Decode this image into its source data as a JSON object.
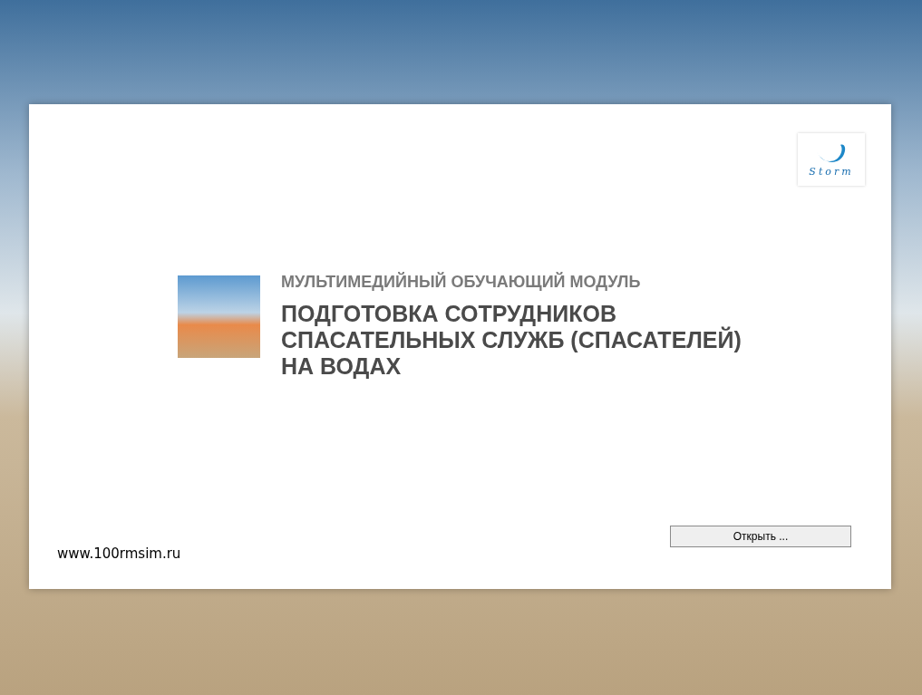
{
  "logo": {
    "text": "Storm"
  },
  "module": {
    "subtitle": "МУЛЬТИМЕДИЙНЫЙ ОБУЧАЮЩИЙ МОДУЛЬ",
    "title_lines": [
      "ПОДГОТОВКА СОТРУДНИКОВ",
      "СПАСАТЕЛЬНЫХ СЛУЖБ (СПАСАТЕЛЕЙ)",
      "НА ВОДАХ"
    ]
  },
  "website": "www.100rmsim.ru",
  "open_button": "Открыть ..."
}
